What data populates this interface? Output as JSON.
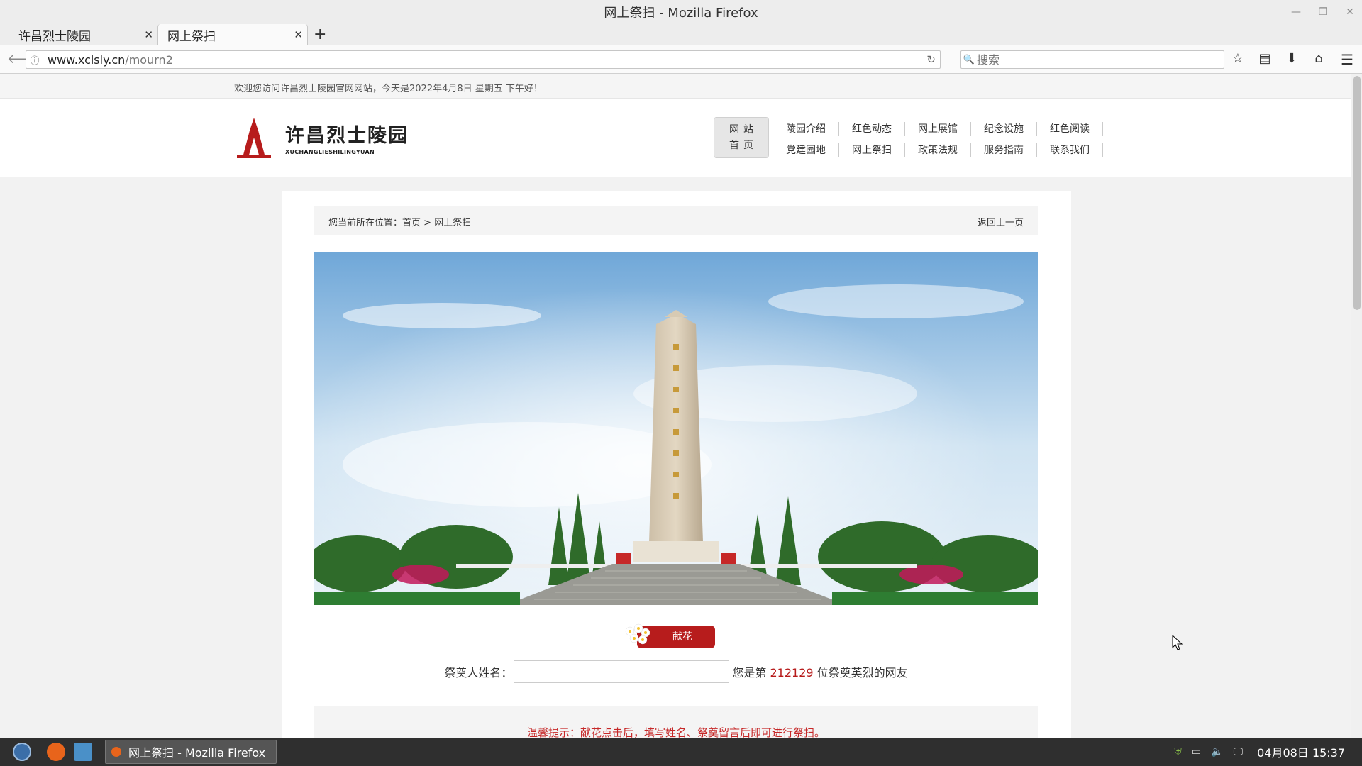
{
  "window": {
    "title": "网上祭扫 - Mozilla Firefox"
  },
  "tabs": [
    {
      "label": "许昌烈士陵园"
    },
    {
      "label": "网上祭扫"
    }
  ],
  "navbar": {
    "url_host": "www.xclsly.cn",
    "url_path": "/mourn2",
    "search_placeholder": "搜索"
  },
  "page": {
    "welcome": "欢迎您访问许昌烈士陵园官网网站，今天是2022年4月8日 星期五 下午好！",
    "logo": {
      "cn": "许昌烈士陵园",
      "en": "XUCHANGLIESHILINGYUAN"
    },
    "home": {
      "line1": "网站",
      "line2": "首页"
    },
    "nav": [
      "陵园介绍",
      "红色动态",
      "网上展馆",
      "纪念设施",
      "红色阅读",
      "党建园地",
      "网上祭扫",
      "政策法规",
      "服务指南",
      "联系我们"
    ],
    "breadcrumb": {
      "prefix": "您当前所在位置：",
      "home": "首页",
      "sep": " > ",
      "current": "网上祭扫",
      "back": "返回上一页"
    },
    "offer_button": "献花",
    "form": {
      "label": "祭奠人姓名：",
      "count_prefix": "您是第 ",
      "count": "212129",
      "count_suffix": " 位祭奠英烈的网友"
    },
    "tip": "温馨提示：献花点击后，填写姓名、祭奠留言后即可进行祭扫。"
  },
  "taskbar": {
    "window_label": "网上祭扫 - Mozilla Firefox",
    "clock": "04月08日 15:37"
  },
  "colors": {
    "accent_red": "#b71c1c",
    "tip_red": "#c62828"
  }
}
